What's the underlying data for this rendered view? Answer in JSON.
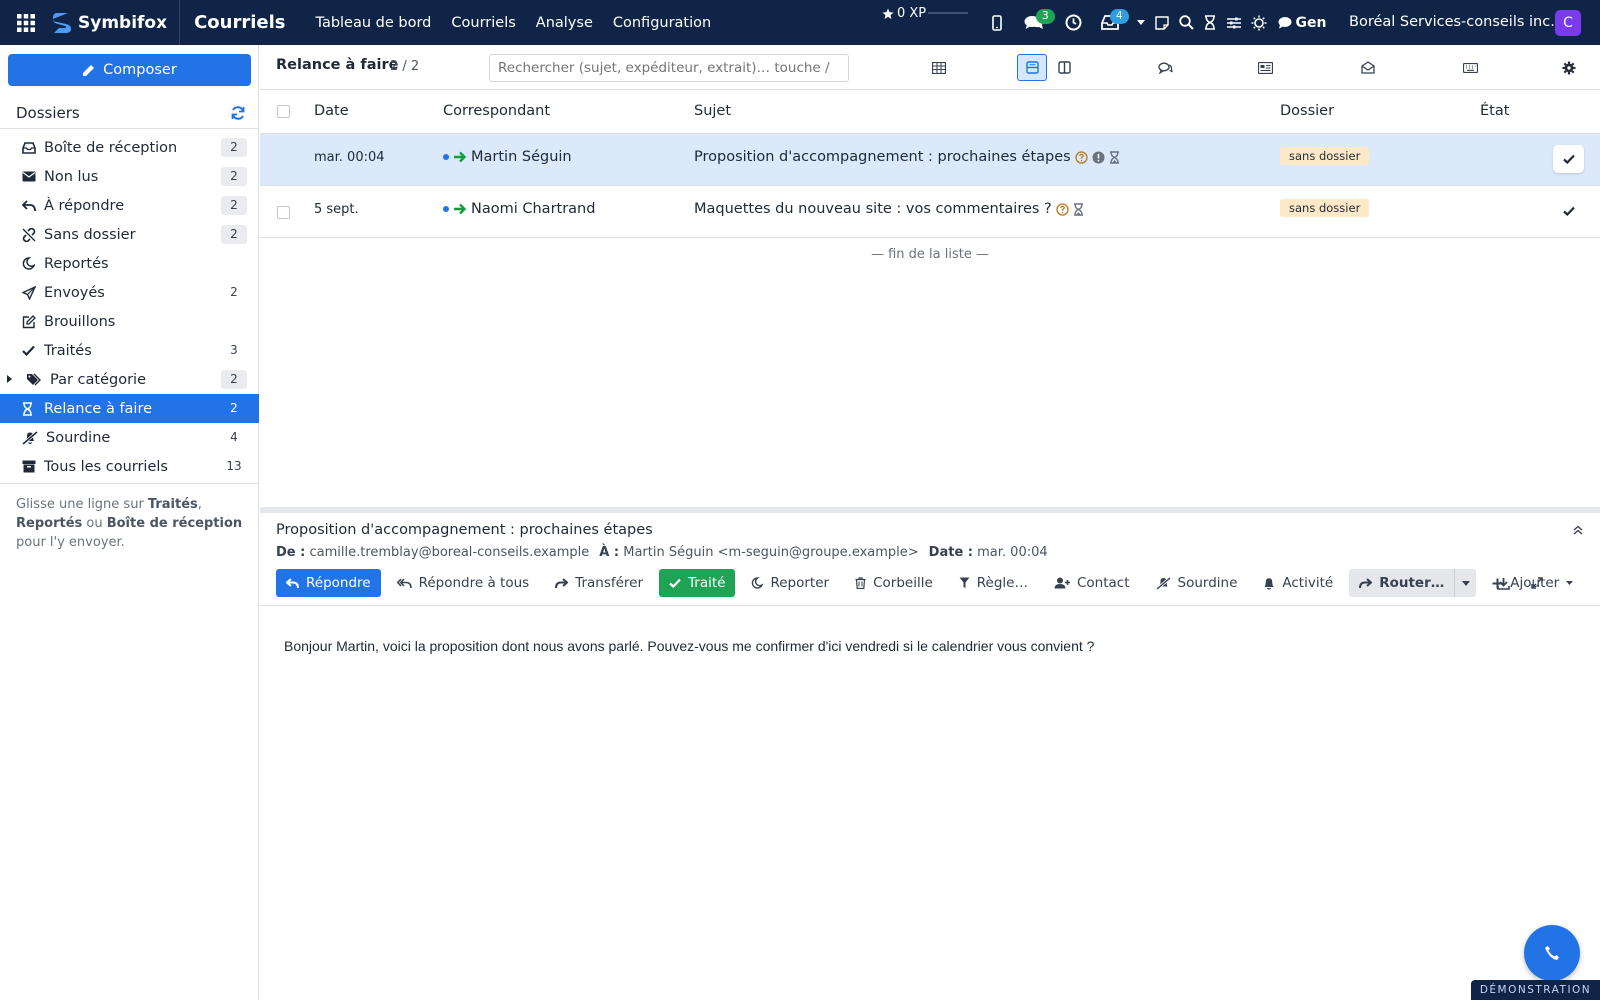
{
  "topbar": {
    "brand": "Symbifox",
    "app_title": "Courriels",
    "nav": [
      "Tableau de bord",
      "Courriels",
      "Analyse",
      "Configuration"
    ],
    "xp": "0 XP",
    "chat_badge": "3",
    "inbox_badge": "4",
    "gen_label": "Gen",
    "company": "Boréal Services-conseils inc.",
    "avatar_letter": "C",
    "colors": {
      "bar": "#0f2447",
      "chat_badge": "#21a356",
      "inbox_badge": "#2d9fe0"
    }
  },
  "sidebar": {
    "compose_label": "Composer",
    "folders_title": "Dossiers",
    "items": [
      {
        "label": "Boîte de réception",
        "count": "2",
        "icon": "inbox-icon",
        "boxed": true
      },
      {
        "label": "Non lus",
        "count": "2",
        "icon": "envelope-icon",
        "boxed": true
      },
      {
        "label": "À répondre",
        "count": "2",
        "icon": "reply-icon",
        "boxed": true
      },
      {
        "label": "Sans dossier",
        "count": "2",
        "icon": "unlink-icon",
        "boxed": true
      },
      {
        "label": "Reportés",
        "count": "",
        "icon": "moon-icon",
        "boxed": false
      },
      {
        "label": "Envoyés",
        "count": "2",
        "icon": "paper-plane-icon",
        "boxed": false
      },
      {
        "label": "Brouillons",
        "count": "",
        "icon": "edit-icon",
        "boxed": false
      },
      {
        "label": "Traités",
        "count": "3",
        "icon": "check-icon",
        "boxed": false
      },
      {
        "label": "Par catégorie",
        "count": "2",
        "icon": "tags-icon",
        "boxed": true
      },
      {
        "label": "Relance à faire",
        "count": "2",
        "icon": "hourglass-icon",
        "boxed": false,
        "active": true
      },
      {
        "label": "Sourdine",
        "count": "4",
        "icon": "bell-slash-icon",
        "boxed": false
      },
      {
        "label": "Tous les courriels",
        "count": "13",
        "icon": "archive-icon",
        "boxed": false
      }
    ],
    "note": {
      "p1": "Glisse une ligne sur ",
      "b1": "Traités",
      "p2": ", ",
      "b2": "Reportés",
      "p3": " ou ",
      "b3": "Boîte de réception",
      "p4": " pour l'y envoyer."
    }
  },
  "list": {
    "title": "Relance à faire",
    "count": "2 / 2",
    "search_placeholder": "Rechercher (sujet, expéditeur, extrait)… touche /",
    "columns": [
      "Date",
      "Correspondant",
      "Sujet",
      "Dossier",
      "État"
    ],
    "rows": [
      {
        "date": "mar. 00:04",
        "correspondent": "Martin Séguin",
        "subject": "Proposition d'accompagnement : prochaines étapes",
        "folder": "sans dossier",
        "selected": true
      },
      {
        "date": "5 sept.",
        "correspondent": "Naomi Chartrand",
        "subject": "Maquettes du nouveau site : vos commentaires ?",
        "folder": "sans dossier",
        "selected": false
      }
    ],
    "end_of_list": "— fin de la liste —"
  },
  "preview": {
    "subject": "Proposition d'accompagnement : prochaines étapes",
    "from_label": "De :",
    "from": "camille.tremblay@boreal-conseils.example",
    "to_label": "À :",
    "to": "Martin Séguin <m-seguin@groupe.example>",
    "date_label": "Date :",
    "date": "mar. 00:04",
    "actions": {
      "reply": "Répondre",
      "reply_all": "Répondre à tous",
      "forward": "Transférer",
      "done": "Traité",
      "snooze": "Reporter",
      "trash": "Corbeille",
      "rule": "Règle…",
      "contact": "Contact",
      "mute": "Sourdine",
      "activity": "Activité",
      "route": "Router…",
      "add": "Ajouter"
    },
    "body": "Bonjour Martin, voici la proposition dont nous avons parlé. Pouvez-vous me confirmer d'ici vendredi si le calendrier vous convient ?"
  },
  "footer": {
    "demo": "DÉMONSTRATION"
  }
}
